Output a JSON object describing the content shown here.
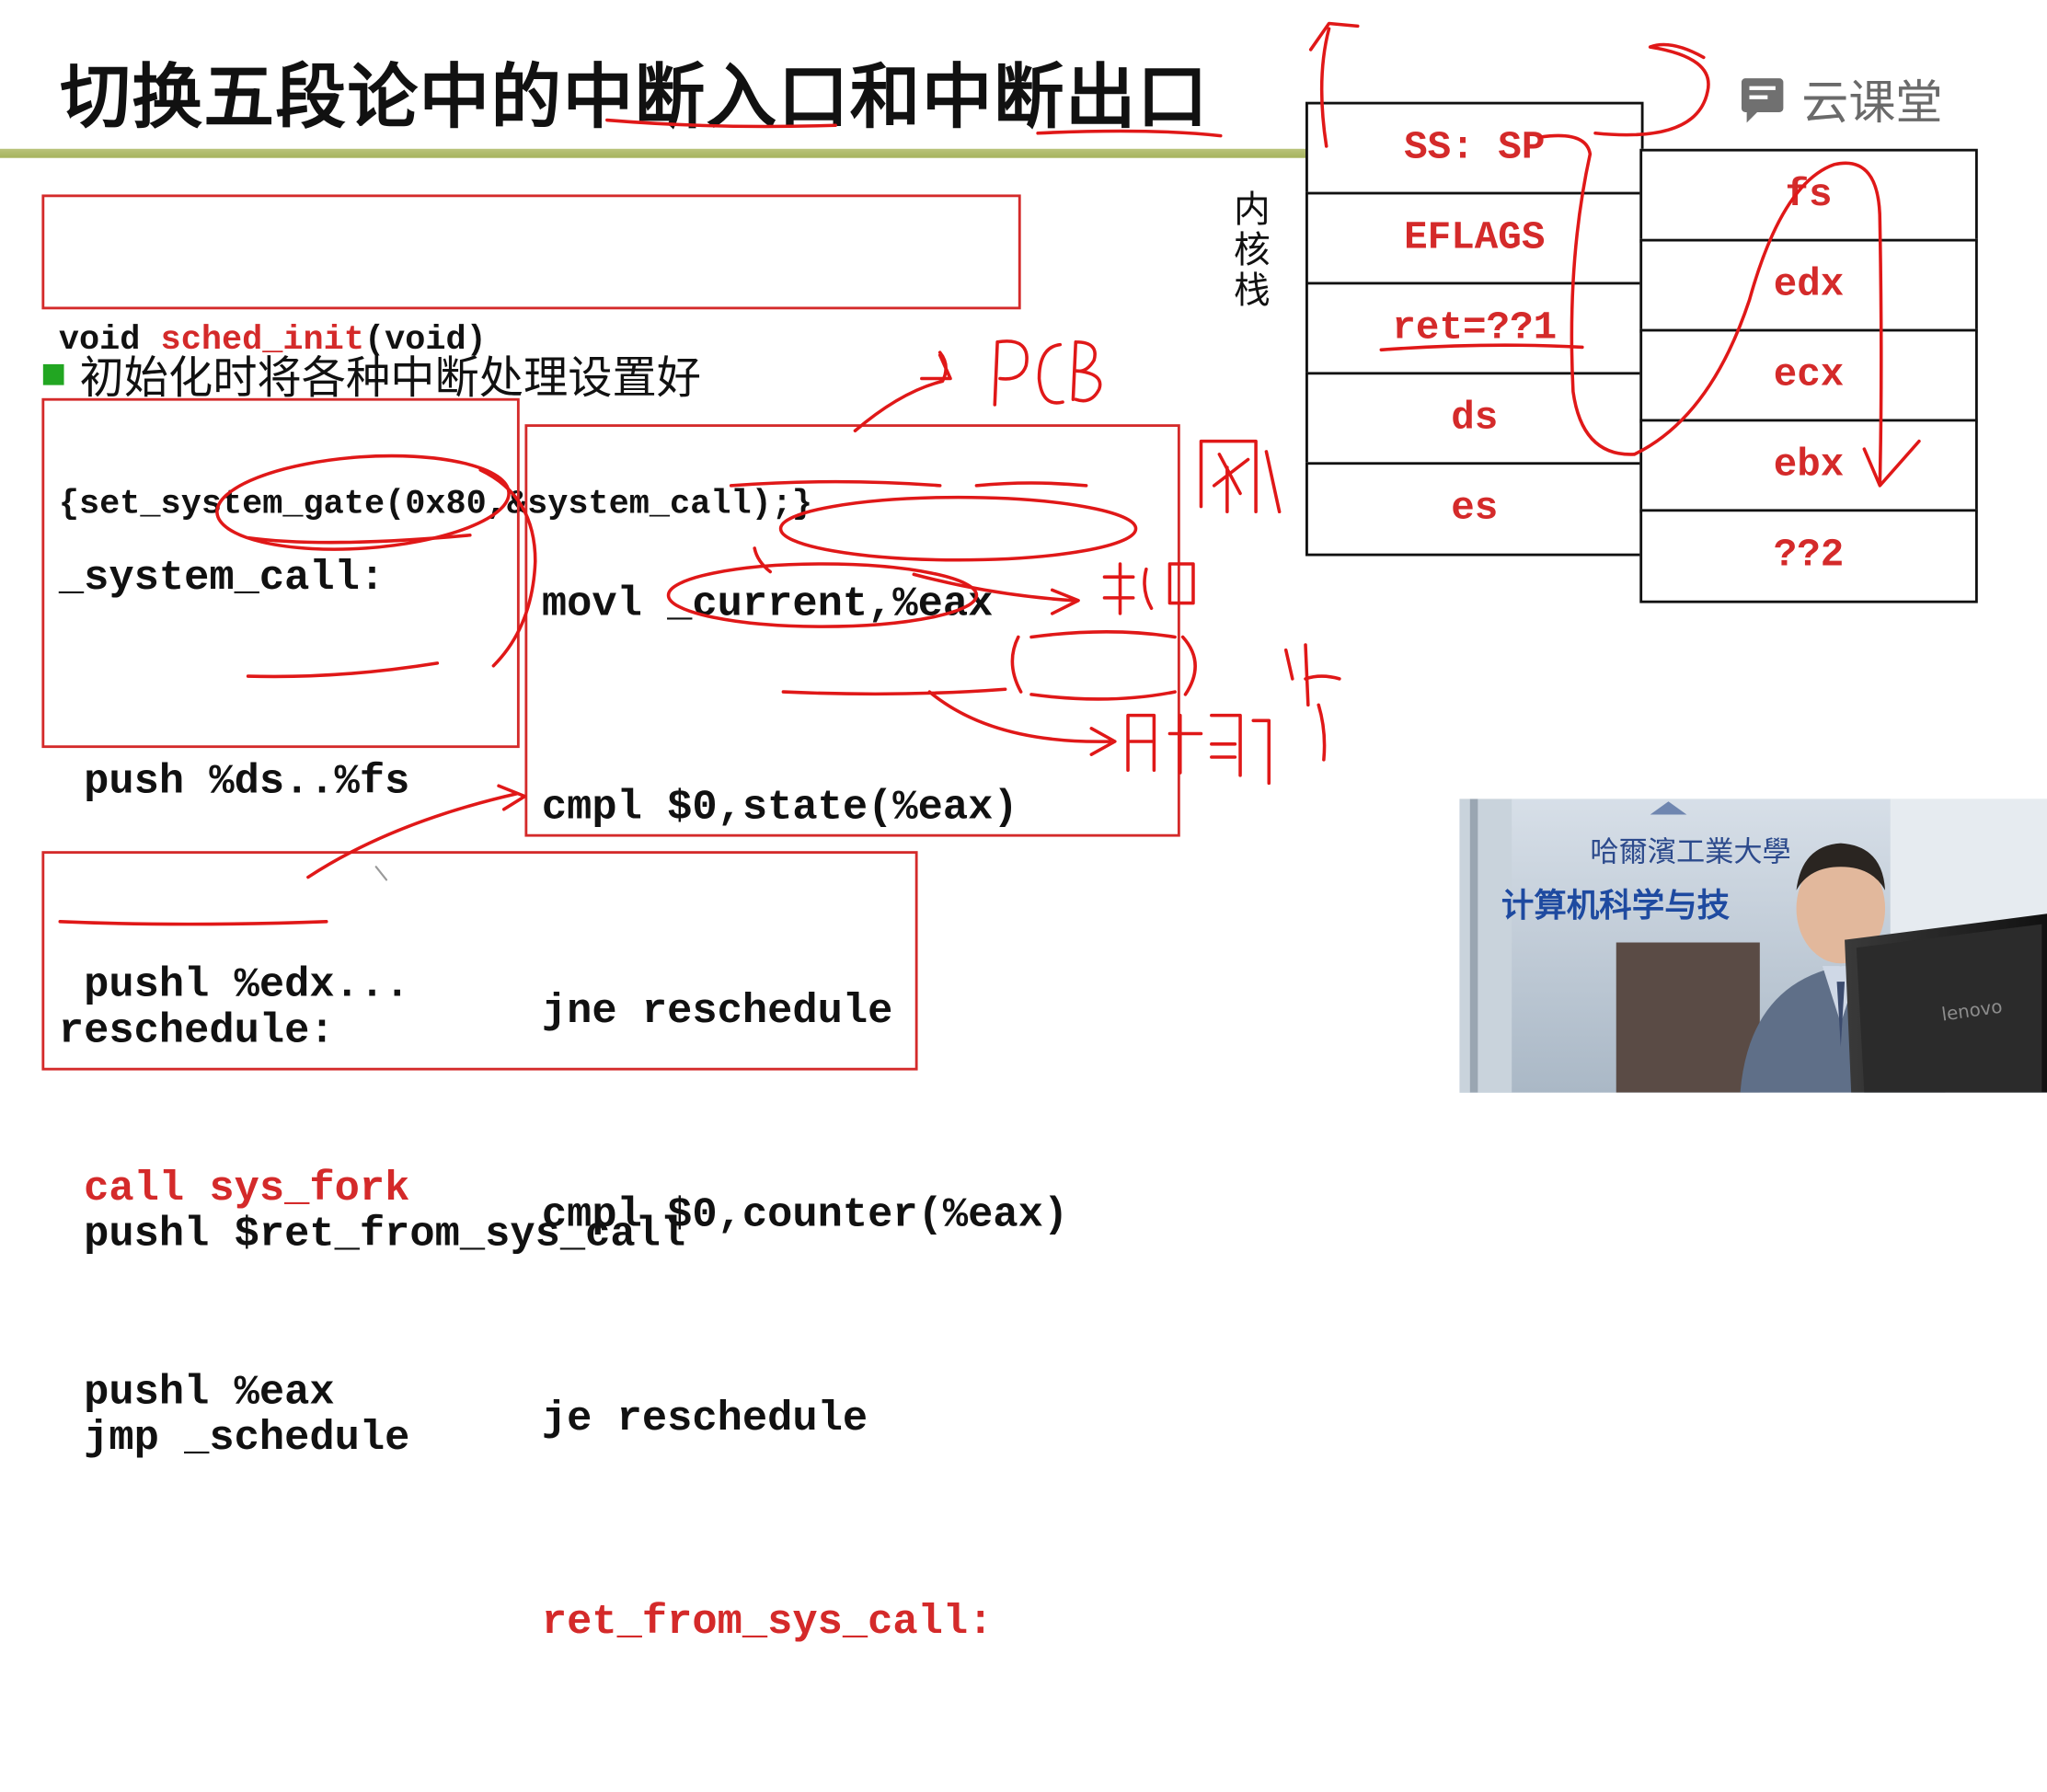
{
  "slide": {
    "title": "切换五段论中的中断入口和中断出口",
    "brand": {
      "name": "云课堂",
      "icon": "cloud-classroom-icon"
    },
    "init_code": {
      "line1_prefix": "void ",
      "line1_func": "sched_init",
      "line1_suffix": "(void)",
      "line2": "{set_system_gate(0x80,&system_call);}"
    },
    "bullet": "初始化时将各种中断处理设置好",
    "system_call": {
      "label": "_system_call:",
      "lines": [
        " push %ds..%fs",
        " pushl %edx...",
        " call sys_fork",
        " pushl %eax"
      ]
    },
    "check_code": {
      "lines": [
        "movl _current,%eax",
        "cmpl $0,state(%eax)",
        "jne reschedule",
        "cmpl $0,counter(%eax)",
        "je reschedule",
        "ret_from_sys_call:"
      ]
    },
    "reschedule": {
      "lines": [
        "reschedule:",
        " pushl $ret_from_sys_call",
        " jmp _schedule"
      ]
    },
    "kernel_stack": {
      "label": "内核栈",
      "left_cells": [
        "SS: SP",
        "EFLAGS",
        "ret=??1",
        "ds",
        "es"
      ],
      "right_cells": [
        "fs",
        "edx",
        "ecx",
        "ebx",
        "??2"
      ]
    },
    "video": {
      "banner_school": "哈爾濱工業大學",
      "banner_dept": "计算机科学与技",
      "monitor_brand": "lenovo"
    },
    "colors": {
      "accent_red": "#d42a2a",
      "bullet_green": "#22a622",
      "title_rule": "#b0bb6a"
    }
  }
}
